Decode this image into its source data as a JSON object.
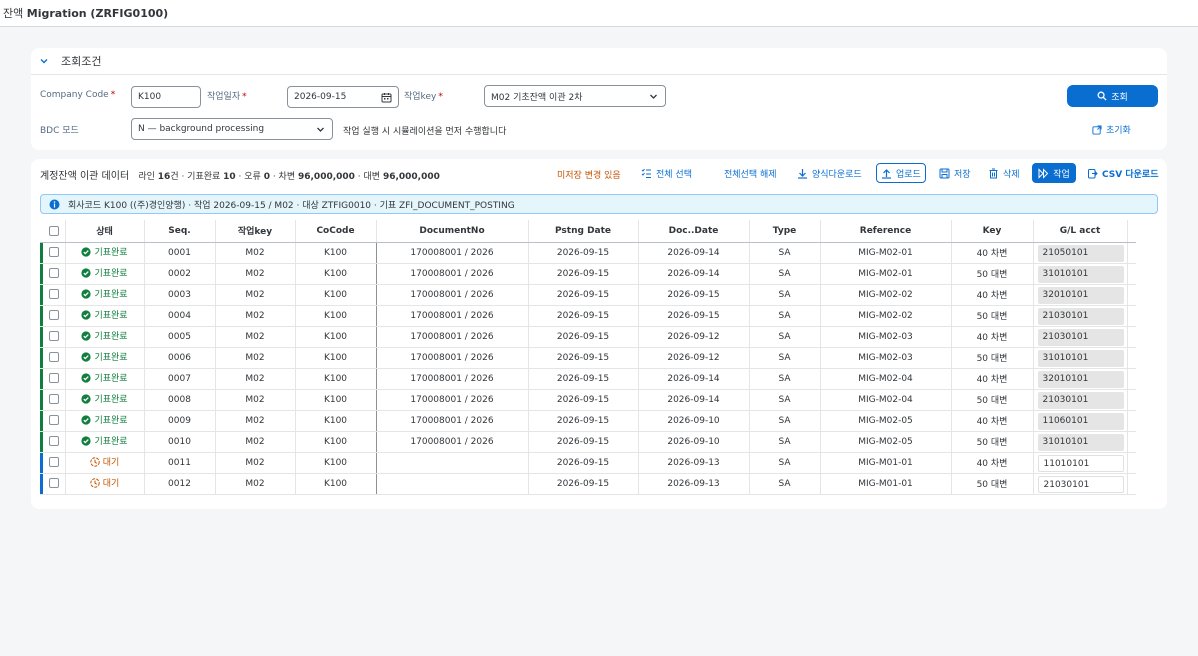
{
  "app": {
    "title_prefix": "잔액 ",
    "title_bold": "Migration (ZRFIG0100)"
  },
  "filter": {
    "title": "조회조건",
    "company_code_label": "Company Code",
    "company_code_value": "K100",
    "work_date_label": "작업일자",
    "work_date_value": "2026-09-15",
    "work_key_label": "작업key",
    "work_key_value": "M02 기초잔액 이관 2차",
    "bdc_label": "BDC 모드",
    "bdc_value": "N — background processing",
    "bdc_hint": "작업 실행 시 시뮬레이션을 먼저 수행합니다",
    "search_button": "조회",
    "reset_button": "초기화"
  },
  "toolbar": {
    "title": "계정잔액 이관 데이터",
    "summary_parts": {
      "p1": "라인 ",
      "lines": "16",
      "p2": "건 · 기표완료 ",
      "done": "10",
      "p3": " · 오류 ",
      "errors": "0",
      "p4": " · 차변 ",
      "debit": "96,000,000",
      "p5": " · 대변 ",
      "credit": "96,000,000"
    },
    "unsaved": "미저장 변경 있음",
    "select_all": "전체 선택",
    "deselect_all": "전체선택 해제",
    "template_download": "양식다운로드",
    "upload": "업로드",
    "save": "저장",
    "delete": "삭제",
    "execute": "작업",
    "csv_download": "CSV 다운로드"
  },
  "info": "회사코드 K100 ((주)경인양행) · 작업 2026-09-15 / M02 · 대상 ZTFIG0010 · 기표 ZFI_DOCUMENT_POSTING",
  "table": {
    "columns": [
      "상태",
      "Seq.",
      "작업key",
      "CoCode",
      "DocumentNo",
      "Pstng Date",
      "Doc..Date",
      "Type",
      "Reference",
      "Key",
      "G/L acct"
    ],
    "rows": [
      {
        "status": "기표완료",
        "state": "done",
        "seq": "0001",
        "key": "M02",
        "cocode": "K100",
        "docno": "170008001 / 2026",
        "pdate": "2026-09-15",
        "ddate": "2026-09-14",
        "type": "SA",
        "ref": "MIG-M02-01",
        "pk": "40 차변",
        "gl": "21050101"
      },
      {
        "status": "기표완료",
        "state": "done",
        "seq": "0002",
        "key": "M02",
        "cocode": "K100",
        "docno": "170008001 / 2026",
        "pdate": "2026-09-15",
        "ddate": "2026-09-14",
        "type": "SA",
        "ref": "MIG-M02-01",
        "pk": "50 대변",
        "gl": "31010101"
      },
      {
        "status": "기표완료",
        "state": "done",
        "seq": "0003",
        "key": "M02",
        "cocode": "K100",
        "docno": "170008001 / 2026",
        "pdate": "2026-09-15",
        "ddate": "2026-09-15",
        "type": "SA",
        "ref": "MIG-M02-02",
        "pk": "40 차변",
        "gl": "32010101"
      },
      {
        "status": "기표완료",
        "state": "done",
        "seq": "0004",
        "key": "M02",
        "cocode": "K100",
        "docno": "170008001 / 2026",
        "pdate": "2026-09-15",
        "ddate": "2026-09-15",
        "type": "SA",
        "ref": "MIG-M02-02",
        "pk": "50 대변",
        "gl": "21030101"
      },
      {
        "status": "기표완료",
        "state": "done",
        "seq": "0005",
        "key": "M02",
        "cocode": "K100",
        "docno": "170008001 / 2026",
        "pdate": "2026-09-15",
        "ddate": "2026-09-12",
        "type": "SA",
        "ref": "MIG-M02-03",
        "pk": "40 차변",
        "gl": "21030101"
      },
      {
        "status": "기표완료",
        "state": "done",
        "seq": "0006",
        "key": "M02",
        "cocode": "K100",
        "docno": "170008001 / 2026",
        "pdate": "2026-09-15",
        "ddate": "2026-09-12",
        "type": "SA",
        "ref": "MIG-M02-03",
        "pk": "50 대변",
        "gl": "31010101"
      },
      {
        "status": "기표완료",
        "state": "done",
        "seq": "0007",
        "key": "M02",
        "cocode": "K100",
        "docno": "170008001 / 2026",
        "pdate": "2026-09-15",
        "ddate": "2026-09-14",
        "type": "SA",
        "ref": "MIG-M02-04",
        "pk": "40 차변",
        "gl": "32010101"
      },
      {
        "status": "기표완료",
        "state": "done",
        "seq": "0008",
        "key": "M02",
        "cocode": "K100",
        "docno": "170008001 / 2026",
        "pdate": "2026-09-15",
        "ddate": "2026-09-14",
        "type": "SA",
        "ref": "MIG-M02-04",
        "pk": "50 대변",
        "gl": "21030101"
      },
      {
        "status": "기표완료",
        "state": "done",
        "seq": "0009",
        "key": "M02",
        "cocode": "K100",
        "docno": "170008001 / 2026",
        "pdate": "2026-09-15",
        "ddate": "2026-09-10",
        "type": "SA",
        "ref": "MIG-M02-05",
        "pk": "40 차변",
        "gl": "11060101"
      },
      {
        "status": "기표완료",
        "state": "done",
        "seq": "0010",
        "key": "M02",
        "cocode": "K100",
        "docno": "170008001 / 2026",
        "pdate": "2026-09-15",
        "ddate": "2026-09-10",
        "type": "SA",
        "ref": "MIG-M02-05",
        "pk": "50 대변",
        "gl": "31010101"
      },
      {
        "status": "대기",
        "state": "wait",
        "seq": "0011",
        "key": "M02",
        "cocode": "K100",
        "docno": "",
        "pdate": "2026-09-15",
        "ddate": "2026-09-13",
        "type": "SA",
        "ref": "MIG-M01-01",
        "pk": "40 차변",
        "gl": "11010101"
      },
      {
        "status": "대기",
        "state": "wait",
        "seq": "0012",
        "key": "M02",
        "cocode": "K100",
        "docno": "",
        "pdate": "2026-09-15",
        "ddate": "2026-09-13",
        "type": "SA",
        "ref": "MIG-M01-01",
        "pk": "50 대변",
        "gl": "21030101"
      }
    ]
  },
  "colors": {
    "accent": "#0a6ed1",
    "success": "#107e3e",
    "warning": "#c35500",
    "required": "#bb0000"
  }
}
